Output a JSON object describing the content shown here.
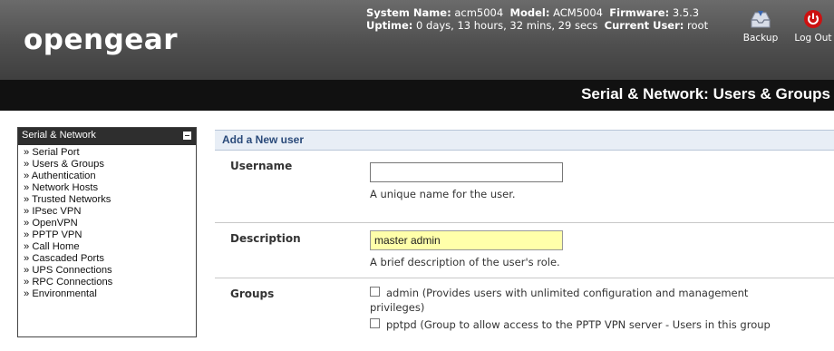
{
  "header": {
    "logo": "opengear",
    "system_name_label": "System Name:",
    "system_name": "acm5004",
    "model_label": "Model:",
    "model": "ACM5004",
    "firmware_label": "Firmware:",
    "firmware": "3.5.3",
    "uptime_label": "Uptime:",
    "uptime": "0 days, 13 hours, 32 mins, 29 secs",
    "current_user_label": "Current User:",
    "current_user": "root",
    "backup_label": "Backup",
    "logout_label": "Log Out"
  },
  "page_title": "Serial & Network: Users & Groups",
  "sidebar": {
    "title": "Serial & Network",
    "items": [
      "Serial Port",
      "Users & Groups",
      "Authentication",
      "Network Hosts",
      "Trusted Networks",
      "IPsec VPN",
      "OpenVPN",
      "PPTP VPN",
      "Call Home",
      "Cascaded Ports",
      "UPS Connections",
      "RPC Connections",
      "Environmental"
    ]
  },
  "form": {
    "section_title": "Add a New user",
    "username": {
      "label": "Username",
      "value": "",
      "hint": "A unique name for the user."
    },
    "description": {
      "label": "Description",
      "value": "master admin",
      "hint": "A brief description of the user's role."
    },
    "groups": {
      "label": "Groups",
      "admin_line1": "admin (Provides users with unlimited configuration and management",
      "admin_line2": "privileges)",
      "pptpd_line": "pptpd (Group to allow access to the PPTP VPN server - Users in this group"
    }
  },
  "colors": {
    "header_bg": "#4f4f4f",
    "title_bar_bg": "#111111",
    "section_head_bg": "#e8eef6",
    "filled_input_bg": "#ffffaa",
    "logout_icon": "#cc1111"
  }
}
